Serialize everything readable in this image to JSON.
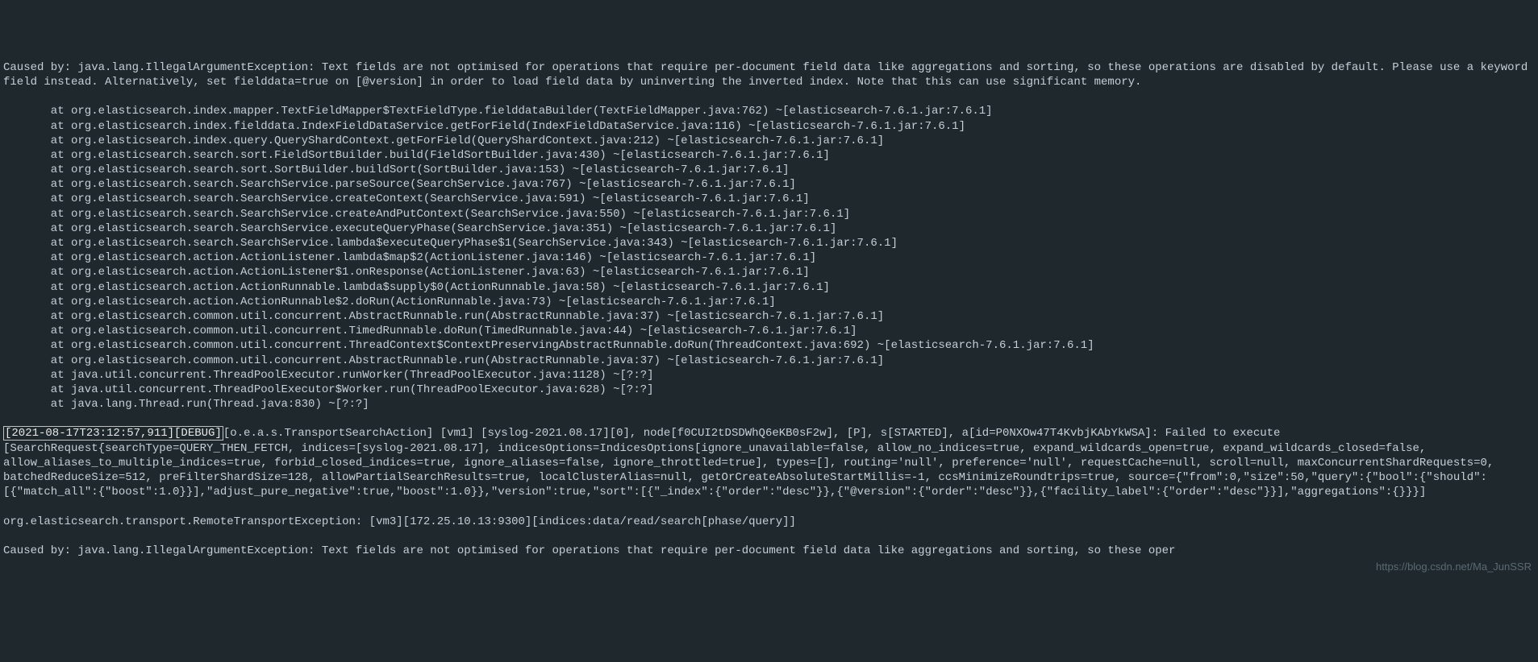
{
  "log": {
    "causedBy": "Caused by: java.lang.IllegalArgumentException: Text fields are not optimised for operations that require per-document field data like aggregations and sorting, so these operations are disabled by default. Please use a keyword field instead. Alternatively, set fielddata=true on [@version] in order to load field data by uninverting the inverted index. Note that this can use significant memory.",
    "stack": [
      "at org.elasticsearch.index.mapper.TextFieldMapper$TextFieldType.fielddataBuilder(TextFieldMapper.java:762) ~[elasticsearch-7.6.1.jar:7.6.1]",
      "at org.elasticsearch.index.fielddata.IndexFieldDataService.getForField(IndexFieldDataService.java:116) ~[elasticsearch-7.6.1.jar:7.6.1]",
      "at org.elasticsearch.index.query.QueryShardContext.getForField(QueryShardContext.java:212) ~[elasticsearch-7.6.1.jar:7.6.1]",
      "at org.elasticsearch.search.sort.FieldSortBuilder.build(FieldSortBuilder.java:430) ~[elasticsearch-7.6.1.jar:7.6.1]",
      "at org.elasticsearch.search.sort.SortBuilder.buildSort(SortBuilder.java:153) ~[elasticsearch-7.6.1.jar:7.6.1]",
      "at org.elasticsearch.search.SearchService.parseSource(SearchService.java:767) ~[elasticsearch-7.6.1.jar:7.6.1]",
      "at org.elasticsearch.search.SearchService.createContext(SearchService.java:591) ~[elasticsearch-7.6.1.jar:7.6.1]",
      "at org.elasticsearch.search.SearchService.createAndPutContext(SearchService.java:550) ~[elasticsearch-7.6.1.jar:7.6.1]",
      "at org.elasticsearch.search.SearchService.executeQueryPhase(SearchService.java:351) ~[elasticsearch-7.6.1.jar:7.6.1]",
      "at org.elasticsearch.search.SearchService.lambda$executeQueryPhase$1(SearchService.java:343) ~[elasticsearch-7.6.1.jar:7.6.1]",
      "at org.elasticsearch.action.ActionListener.lambda$map$2(ActionListener.java:146) ~[elasticsearch-7.6.1.jar:7.6.1]",
      "at org.elasticsearch.action.ActionListener$1.onResponse(ActionListener.java:63) ~[elasticsearch-7.6.1.jar:7.6.1]",
      "at org.elasticsearch.action.ActionRunnable.lambda$supply$0(ActionRunnable.java:58) ~[elasticsearch-7.6.1.jar:7.6.1]",
      "at org.elasticsearch.action.ActionRunnable$2.doRun(ActionRunnable.java:73) ~[elasticsearch-7.6.1.jar:7.6.1]",
      "at org.elasticsearch.common.util.concurrent.AbstractRunnable.run(AbstractRunnable.java:37) ~[elasticsearch-7.6.1.jar:7.6.1]",
      "at org.elasticsearch.common.util.concurrent.TimedRunnable.doRun(TimedRunnable.java:44) ~[elasticsearch-7.6.1.jar:7.6.1]",
      "at org.elasticsearch.common.util.concurrent.ThreadContext$ContextPreservingAbstractRunnable.doRun(ThreadContext.java:692) ~[elasticsearch-7.6.1.jar:7.6.1]",
      "at org.elasticsearch.common.util.concurrent.AbstractRunnable.run(AbstractRunnable.java:37) ~[elasticsearch-7.6.1.jar:7.6.1]",
      "at java.util.concurrent.ThreadPoolExecutor.runWorker(ThreadPoolExecutor.java:1128) ~[?:?]",
      "at java.util.concurrent.ThreadPoolExecutor$Worker.run(ThreadPoolExecutor.java:628) ~[?:?]",
      "at java.lang.Thread.run(Thread.java:830) ~[?:?]"
    ],
    "debugHighlight": "[2021-08-17T23:12:57,911][DEBUG]",
    "debugRest": "[o.e.a.s.TransportSearchAction] [vm1] [syslog-2021.08.17][0], node[f0CUI2tDSDWhQ6eKB0sF2w], [P], s[STARTED], a[id=P0NXOw47T4KvbjKAbYkWSA]: Failed to execute [SearchRequest{searchType=QUERY_THEN_FETCH, indices=[syslog-2021.08.17], indicesOptions=IndicesOptions[ignore_unavailable=false, allow_no_indices=true, expand_wildcards_open=true, expand_wildcards_closed=false, allow_aliases_to_multiple_indices=true, forbid_closed_indices=true, ignore_aliases=false, ignore_throttled=true], types=[], routing='null', preference='null', requestCache=null, scroll=null, maxConcurrentShardRequests=0, batchedReduceSize=512, preFilterShardSize=128, allowPartialSearchResults=true, localClusterAlias=null, getOrCreateAbsoluteStartMillis=-1, ccsMinimizeRoundtrips=true, source={\"from\":0,\"size\":50,\"query\":{\"bool\":{\"should\":[{\"match_all\":{\"boost\":1.0}}],\"adjust_pure_negative\":true,\"boost\":1.0}},\"version\":true,\"sort\":[{\"_index\":{\"order\":\"desc\"}},{\"@version\":{\"order\":\"desc\"}},{\"facility_label\":{\"order\":\"desc\"}}],\"aggregations\":{}}}]",
    "remoteException": "org.elasticsearch.transport.RemoteTransportException: [vm3][172.25.10.13:9300][indices:data/read/search[phase/query]]",
    "causedBy2": "Caused by: java.lang.IllegalArgumentException: Text fields are not optimised for operations that require per-document field data like aggregations and sorting, so these oper"
  },
  "watermark": "https://blog.csdn.net/Ma_JunSSR"
}
